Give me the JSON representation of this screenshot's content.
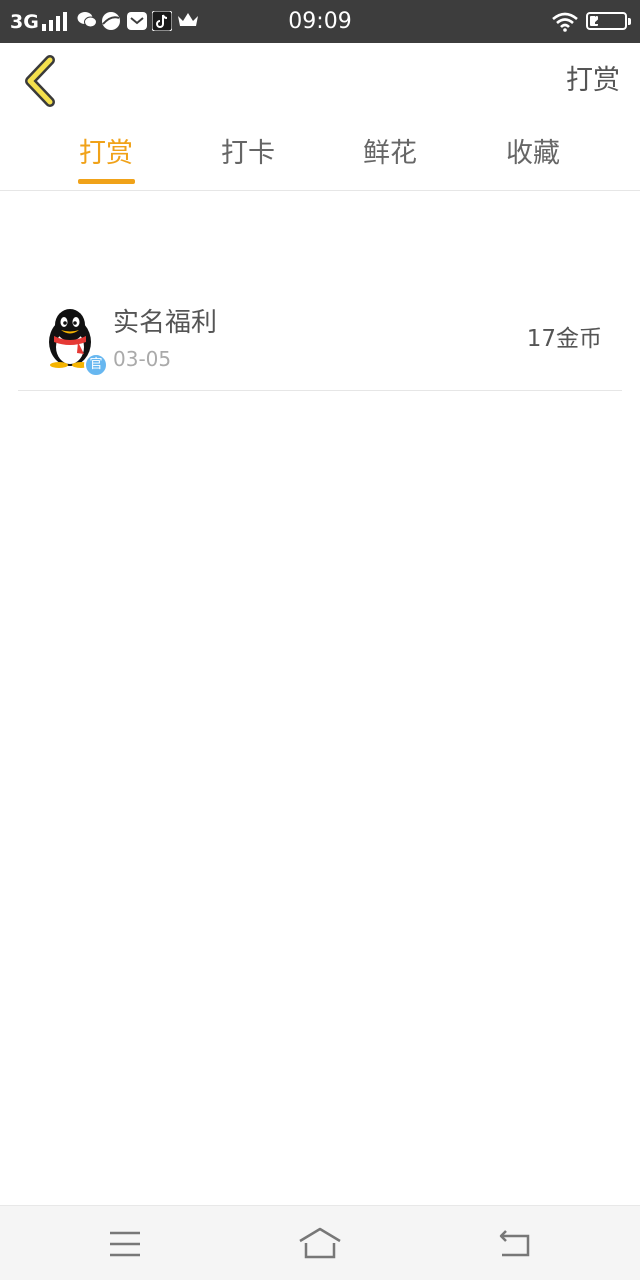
{
  "status_bar": {
    "network": "3G",
    "time": "09:09",
    "battery": "24",
    "battery_level": 0.24,
    "app_icons": [
      "wechat-icon",
      "browser-icon",
      "message-icon",
      "tiktok-icon",
      "crown-icon"
    ]
  },
  "header": {
    "back_icon": "chevron-left-icon",
    "action_label": "打赏"
  },
  "tabs": [
    {
      "label": "打赏",
      "active": true
    },
    {
      "label": "打卡",
      "active": false
    },
    {
      "label": "鲜花",
      "active": false
    },
    {
      "label": "收藏",
      "active": false
    }
  ],
  "list": [
    {
      "avatar": "penguin-avatar",
      "badge": "官",
      "title": "实名福利",
      "date": "03-05",
      "amount": "17金币"
    }
  ],
  "nav_bar": {
    "icons": [
      "menu-icon",
      "home-icon",
      "back-icon"
    ]
  },
  "colors": {
    "accent": "#f0a219",
    "status_bar": "#3d3d3d",
    "badge": "#67b7f0"
  }
}
